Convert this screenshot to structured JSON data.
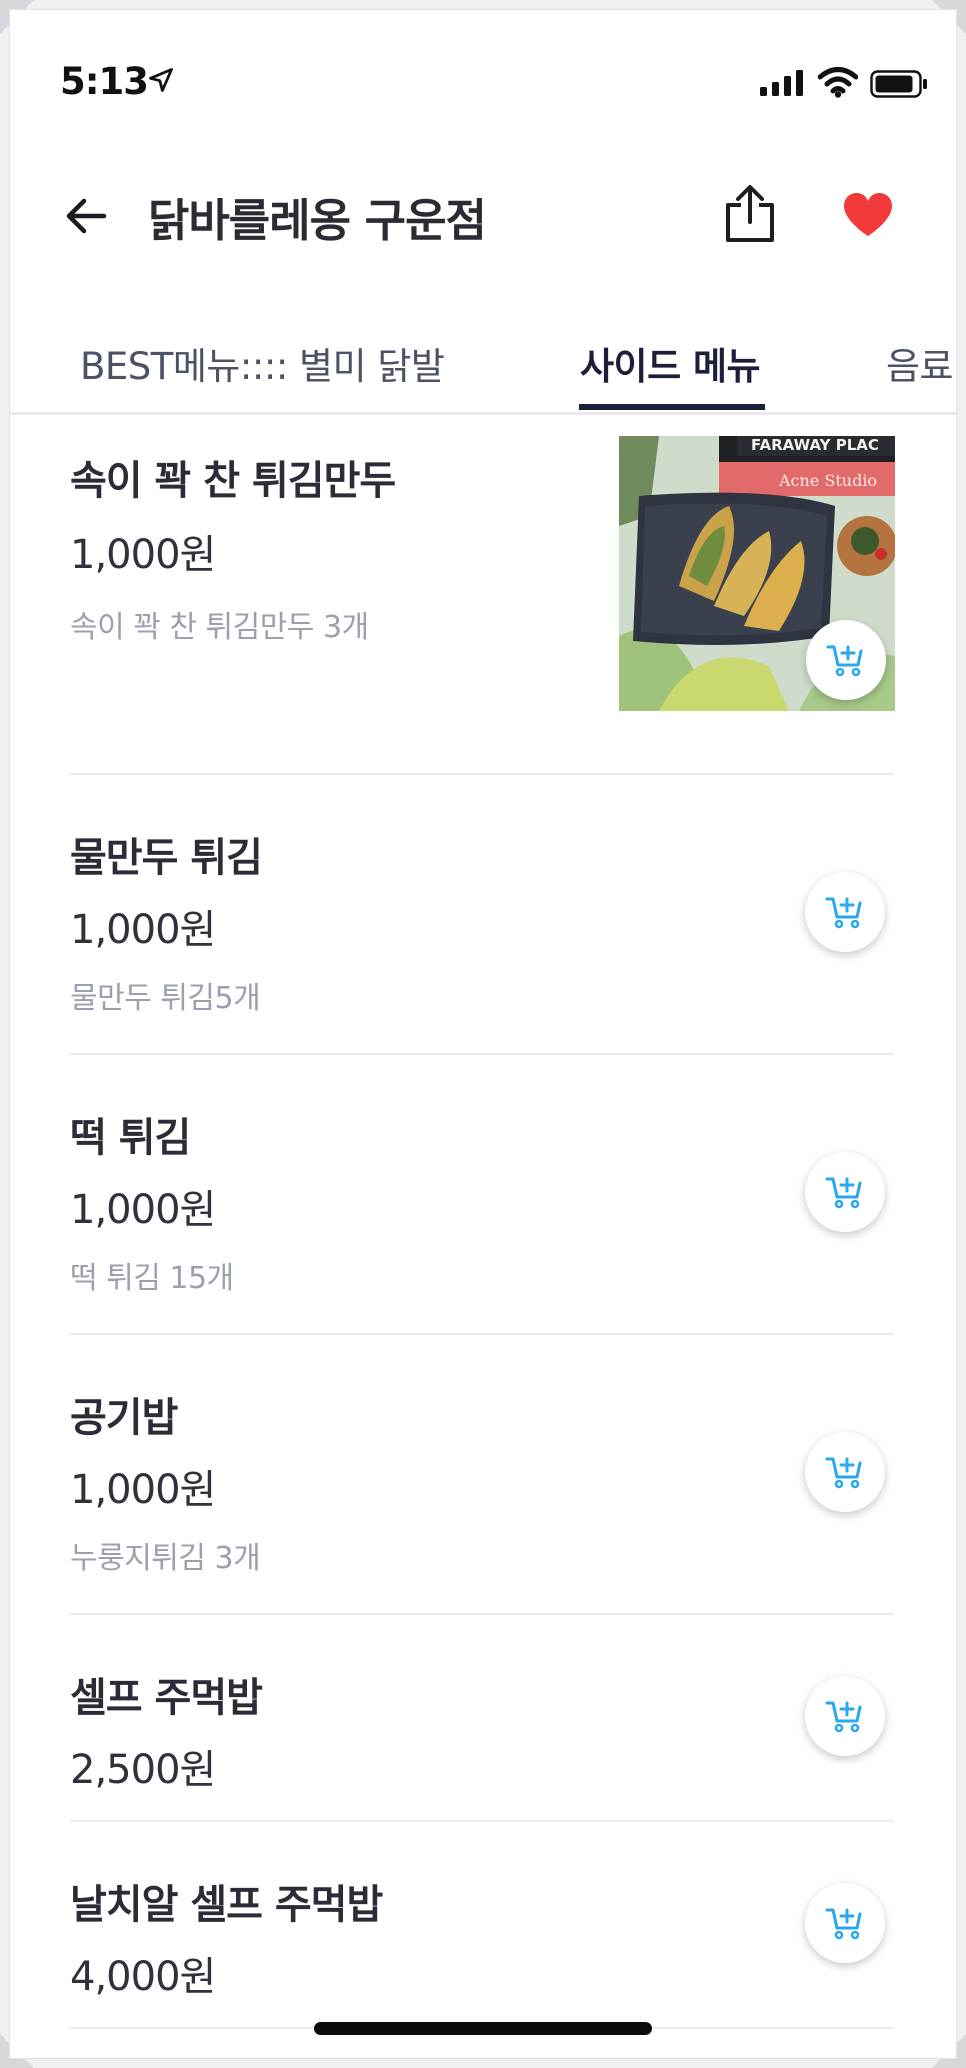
{
  "status_bar": {
    "time": "5:13"
  },
  "header": {
    "title": "닭바를레옹 구운점"
  },
  "tabs": [
    {
      "label": "BEST메뉴:::: 별미 닭발"
    },
    {
      "label": "사이드 메뉴",
      "active": true
    },
    {
      "label": "음료"
    }
  ],
  "photo_text": {
    "line1": "FARAWAY PLAC",
    "line2": "Acne Studio"
  },
  "menu": [
    {
      "name": "속이 꽉 찬 튀김만두",
      "price": "1,000원",
      "desc": "속이 꽉 찬 튀김만두 3개"
    },
    {
      "name": "물만두 튀김",
      "price": "1,000원",
      "desc": "물만두 튀김5개"
    },
    {
      "name": "떡 튀김",
      "price": "1,000원",
      "desc": "떡 튀김 15개"
    },
    {
      "name": "공기밥",
      "price": "1,000원",
      "desc": "누룽지튀김 3개"
    },
    {
      "name": "셀프 주먹밥",
      "price": "2,500원"
    },
    {
      "name": "날치알 셀프 주먹밥",
      "price": "4,000원"
    }
  ],
  "icons": {
    "back": "arrow-left-icon",
    "share": "share-icon",
    "favorite": "heart-icon",
    "cart": "cart-add-icon"
  },
  "colors": {
    "accent_cart": "#2aa8ee",
    "heart": "#f33a3a",
    "active_tab": "#1c1f3b"
  }
}
